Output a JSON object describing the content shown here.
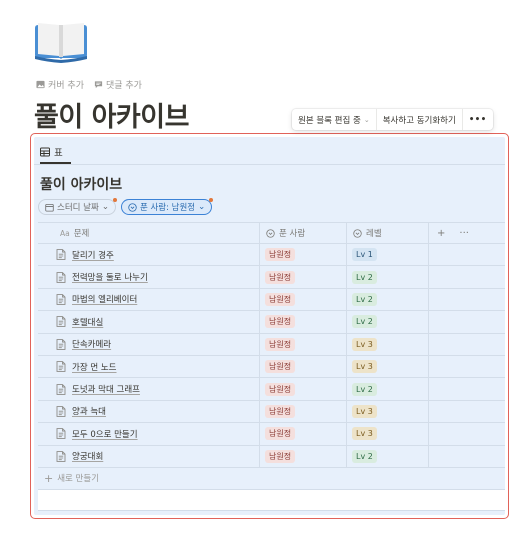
{
  "page": {
    "icon": "book-icon",
    "actions": [
      {
        "icon": "image-icon",
        "label": "커버 추가"
      },
      {
        "icon": "comment-icon",
        "label": "댓글 추가"
      }
    ],
    "title": "풀이 아카이브"
  },
  "sync_bar": {
    "source_label": "원본 블록 편집 중",
    "copy_label": "복사하고 동기화하기",
    "more_label": "•••"
  },
  "database": {
    "view_tab": {
      "icon": "table-icon",
      "label": "표"
    },
    "title": "풀이 아카이브",
    "filters": [
      {
        "icon": "calendar-icon",
        "label": "스터디 날짜",
        "active": false
      },
      {
        "icon": "select-icon",
        "label": "푼 사람: 남원정",
        "active": true
      }
    ],
    "columns": {
      "title": {
        "type_icon": "Aa",
        "label": "문제"
      },
      "solver": {
        "icon": "select-icon",
        "label": "푼 사람"
      },
      "level": {
        "icon": "select-icon",
        "label": "레벨"
      },
      "add": "+",
      "more": "···"
    },
    "rows": [
      {
        "title": "달리기 경주",
        "solver": "남원정",
        "level": "Lv 1"
      },
      {
        "title": "전력망을 둘로 나누기",
        "solver": "남원정",
        "level": "Lv 2"
      },
      {
        "title": "마법의 엘리베이터",
        "solver": "남원정",
        "level": "Lv 2"
      },
      {
        "title": "호텔대실",
        "solver": "남원정",
        "level": "Lv 2"
      },
      {
        "title": "단속카메라",
        "solver": "남원정",
        "level": "Lv 3"
      },
      {
        "title": "가장 먼 노드",
        "solver": "남원정",
        "level": "Lv 3"
      },
      {
        "title": "도넛과 막대 그래프",
        "solver": "남원정",
        "level": "Lv 2"
      },
      {
        "title": "양과 늑대",
        "solver": "남원정",
        "level": "Lv 3"
      },
      {
        "title": "모두 0으로 만들기",
        "solver": "남원정",
        "level": "Lv 3"
      },
      {
        "title": "양궁대회",
        "solver": "남원정",
        "level": "Lv 2"
      }
    ],
    "new_row_label": "새로 만들기"
  },
  "colors": {
    "solver_tag_bg": "#f4dfdd",
    "solver_tag_fg": "#8a3a34",
    "level_1_bg": "#d4e4f2",
    "level_1_fg": "#2a5578",
    "level_2_bg": "#d9ecdf",
    "level_2_fg": "#2e6b45",
    "level_3_bg": "#ede3c9",
    "level_3_fg": "#7a5b1e",
    "sync_border": "#e16259",
    "sync_bg": "#e7f0fb"
  }
}
